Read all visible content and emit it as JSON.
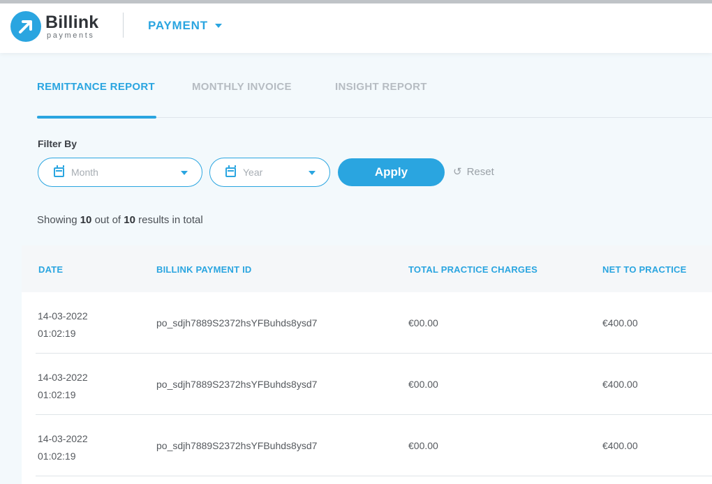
{
  "header": {
    "logo_name": "Billink",
    "logo_sub": "payments",
    "nav_label": "PAYMENT"
  },
  "tabs": [
    {
      "label": "REMITTANCE REPORT",
      "active": true
    },
    {
      "label": "MONTHLY INVOICE",
      "active": false
    },
    {
      "label": "INSIGHT REPORT",
      "active": false
    }
  ],
  "filter": {
    "label": "Filter By",
    "month_placeholder": "Month",
    "year_placeholder": "Year",
    "apply_label": "Apply",
    "reset_label": "Reset"
  },
  "results": {
    "prefix": "Showing ",
    "shown": "10",
    "middle": " out of ",
    "total": "10",
    "suffix": " results in total"
  },
  "table": {
    "columns": [
      "DATE",
      "BILLINK PAYMENT ID",
      "TOTAL PRACTICE CHARGES",
      "NET TO PRACTICE"
    ],
    "rows": [
      {
        "date": "14-03-2022",
        "time": "01:02:19",
        "payment_id": "po_sdjh7889S2372hsYFBuhds8ysd7",
        "charges": "€00.00",
        "net": "€400.00"
      },
      {
        "date": "14-03-2022",
        "time": "01:02:19",
        "payment_id": "po_sdjh7889S2372hsYFBuhds8ysd7",
        "charges": "€00.00",
        "net": "€400.00"
      },
      {
        "date": "14-03-2022",
        "time": "01:02:19",
        "payment_id": "po_sdjh7889S2372hsYFBuhds8ysd7",
        "charges": "€00.00",
        "net": "€400.00"
      }
    ]
  },
  "colors": {
    "accent": "#2aa5e0",
    "background": "#f3f9fc"
  }
}
